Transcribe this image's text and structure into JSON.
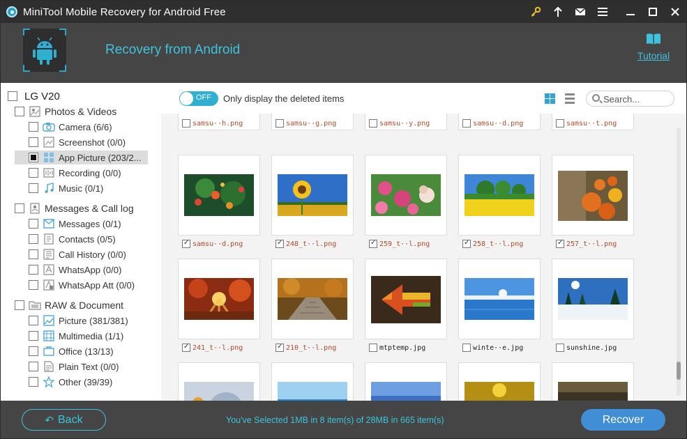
{
  "window": {
    "title": "MiniTool Mobile Recovery for Android Free",
    "controls": [
      "key-icon",
      "upload-icon",
      "mail-icon",
      "menu-icon",
      "minimize-icon",
      "maximize-icon",
      "close-icon"
    ]
  },
  "header": {
    "title": "Recovery from Android",
    "tutorial_label": "Tutorial",
    "accent_color": "#3ec3de"
  },
  "sidebar": {
    "device": "LG V20",
    "groups": [
      {
        "label": "Photos & Videos",
        "icon": "photos-icon",
        "items": [
          {
            "label": "Camera (6/6)",
            "icon": "camera-icon",
            "state": "unchecked"
          },
          {
            "label": "Screenshot (0/0)",
            "icon": "screenshot-icon",
            "state": "unchecked"
          },
          {
            "label": "App Picture (203/2...",
            "icon": "app-picture-icon",
            "state": "partial",
            "selected": true
          },
          {
            "label": "Recording (0/0)",
            "icon": "recording-icon",
            "state": "unchecked"
          },
          {
            "label": "Music (0/1)",
            "icon": "music-icon",
            "state": "unchecked"
          }
        ]
      },
      {
        "label": "Messages & Call log",
        "icon": "messages-group-icon",
        "items": [
          {
            "label": "Messages (0/1)",
            "icon": "message-icon",
            "state": "unchecked"
          },
          {
            "label": "Contacts (0/5)",
            "icon": "contacts-icon",
            "state": "unchecked"
          },
          {
            "label": "Call History (0/0)",
            "icon": "call-history-icon",
            "state": "unchecked"
          },
          {
            "label": "WhatsApp (0/0)",
            "icon": "whatsapp-icon",
            "state": "unchecked"
          },
          {
            "label": "WhatsApp Att (0/0)",
            "icon": "whatsapp-attachment-icon",
            "state": "unchecked"
          }
        ]
      },
      {
        "label": "RAW & Document",
        "icon": "document-group-icon",
        "items": [
          {
            "label": "Picture (381/381)",
            "icon": "picture-icon",
            "state": "unchecked"
          },
          {
            "label": "Multimedia (1/1)",
            "icon": "multimedia-icon",
            "state": "unchecked"
          },
          {
            "label": "Office (13/13)",
            "icon": "office-icon",
            "state": "unchecked"
          },
          {
            "label": "Plain Text (0/0)",
            "icon": "plain-text-icon",
            "state": "unchecked"
          },
          {
            "label": "Other (39/39)",
            "icon": "other-icon",
            "state": "unchecked"
          }
        ]
      }
    ]
  },
  "toolbar": {
    "toggle_label": "OFF",
    "filter_label": "Only display the deleted items",
    "search_placeholder": "Search..."
  },
  "files": {
    "row0": [
      {
        "name": "samsu··h.png",
        "checked": false
      },
      {
        "name": "samsu··g.png",
        "checked": false
      },
      {
        "name": "samsu··y.png",
        "checked": false
      },
      {
        "name": "samsu··d.png",
        "checked": false
      },
      {
        "name": "samsu··t.png",
        "checked": false
      }
    ],
    "row1": [
      {
        "name": "samsu··d.png",
        "checked": true,
        "thumb": "flowers"
      },
      {
        "name": "248_t··l.png",
        "checked": true,
        "thumb": "sunflower"
      },
      {
        "name": "259_t··l.png",
        "checked": true,
        "thumb": "flower-field"
      },
      {
        "name": "258_t··l.png",
        "checked": true,
        "thumb": "yellow-field"
      },
      {
        "name": "257_t··l.png",
        "checked": true,
        "thumb": "pumpkins"
      }
    ],
    "row2": [
      {
        "name": "241_t··l.png",
        "checked": true,
        "thumb": "autumn-forest"
      },
      {
        "name": "210_t··l.png",
        "checked": true,
        "thumb": "boardwalk"
      },
      {
        "name": "mtptemp.jpg",
        "checked": false,
        "thumb": "leaf-arrow"
      },
      {
        "name": "winte··e.jpg",
        "checked": false,
        "thumb": "winter-lake"
      },
      {
        "name": "sunshine.jpg",
        "checked": false,
        "thumb": "snow-sunshine"
      }
    ]
  },
  "footer": {
    "back_label": "Back",
    "status": "You've Selected 1MB in 8 item(s) of 28MB in 665 item(s)",
    "recover_label": "Recover"
  }
}
